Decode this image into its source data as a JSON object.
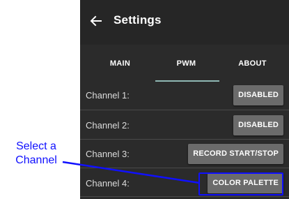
{
  "appbar": {
    "title": "Settings",
    "back_icon": "arrow-left-icon"
  },
  "tabs": [
    {
      "label": "MAIN",
      "selected": false
    },
    {
      "label": "PWM",
      "selected": true
    },
    {
      "label": "ABOUT",
      "selected": false
    }
  ],
  "channels": [
    {
      "label": "Channel 1:",
      "button": "DISABLED"
    },
    {
      "label": "Channel 2:",
      "button": "DISABLED"
    },
    {
      "label": "Channel 3:",
      "button": "RECORD START/STOP"
    },
    {
      "label": "Channel 4:",
      "button": "COLOR PALETTE"
    }
  ],
  "annotation": {
    "line1": "Select a",
    "line2": "Channel",
    "color": "#1010ff"
  },
  "colors": {
    "background": "#2b2b2b",
    "button": "#6b6b6b",
    "indicator": "#8fb8b4"
  }
}
